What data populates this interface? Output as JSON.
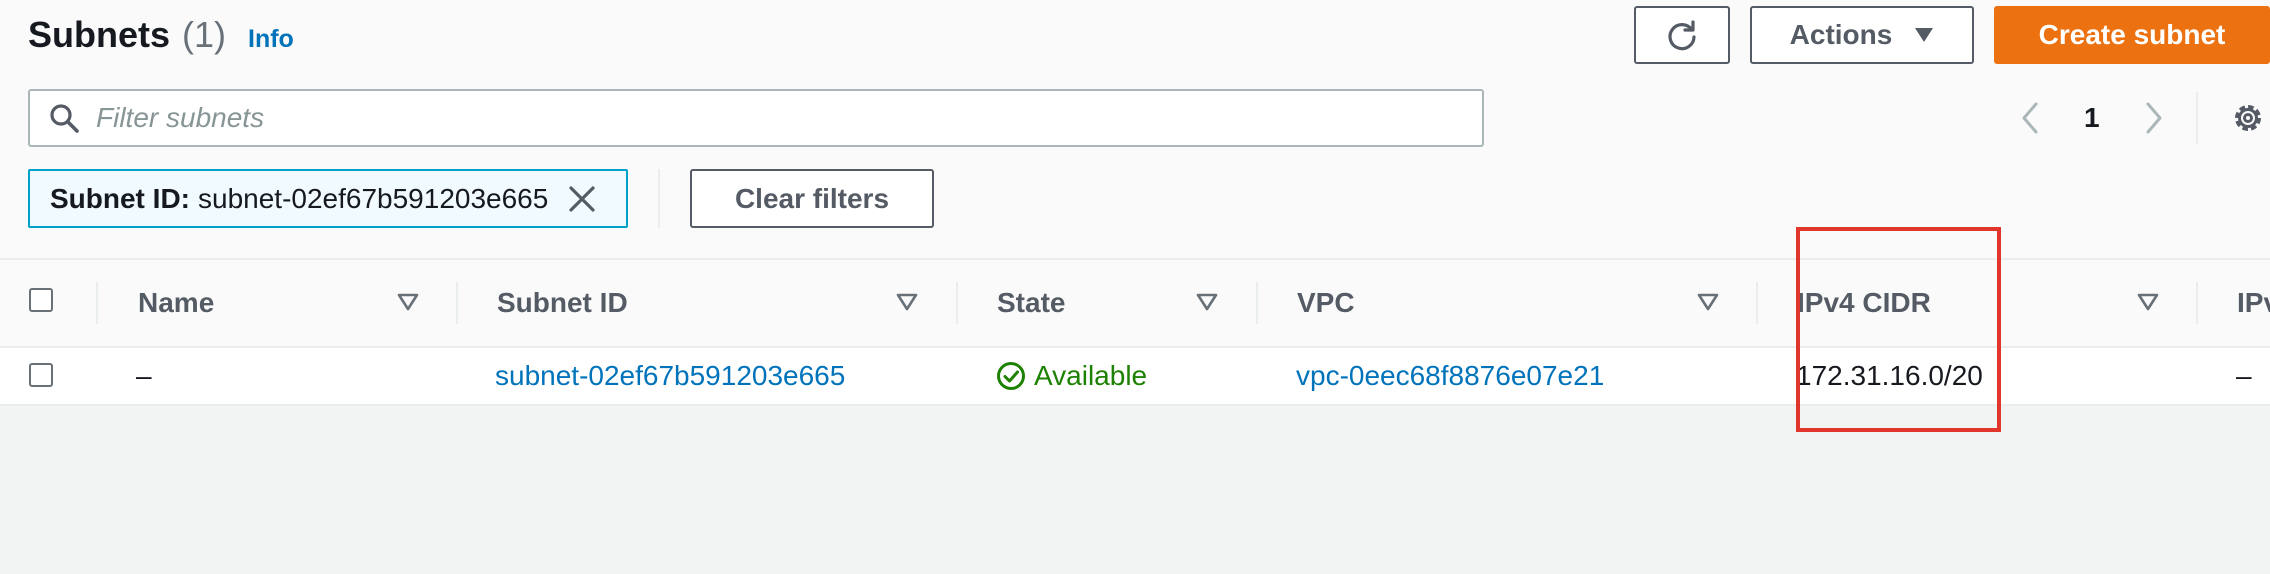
{
  "header": {
    "title": "Subnets",
    "count": "(1)",
    "info_link": "Info"
  },
  "toolbar": {
    "refresh_icon": "refresh-icon",
    "actions_label": "Actions",
    "create_label": "Create subnet"
  },
  "search": {
    "placeholder": "Filter subnets",
    "value": ""
  },
  "pagination": {
    "current_page": "1"
  },
  "filter_token": {
    "key": "Subnet ID:",
    "value": "subnet-02ef67b591203e665"
  },
  "clear_filters_label": "Clear filters",
  "table": {
    "columns": [
      "Name",
      "Subnet ID",
      "State",
      "VPC",
      "IPv4 CIDR",
      "IPv"
    ],
    "rows": [
      {
        "name": "–",
        "subnet_id": "subnet-02ef67b591203e665",
        "state": "Available",
        "vpc": "vpc-0eec68f8876e07e21",
        "ipv4_cidr": "172.31.16.0/20",
        "ipv6": "–"
      }
    ]
  },
  "colors": {
    "accent": "#0073bb",
    "primary_button": "#ec7211",
    "status_available": "#1d8102",
    "highlight_box": "#e0362c"
  }
}
